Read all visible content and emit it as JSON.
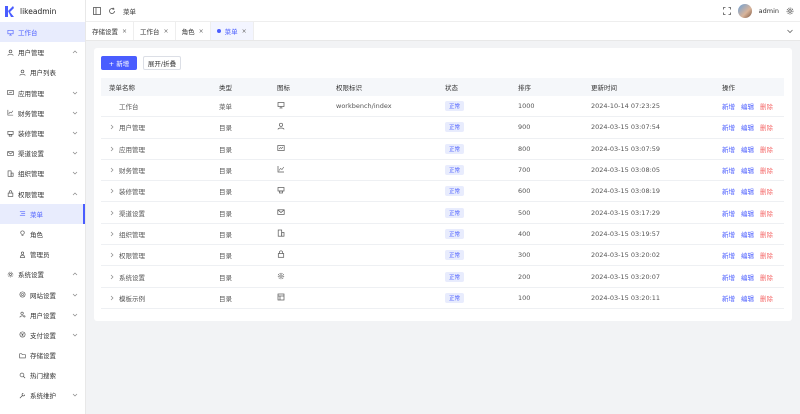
{
  "app": {
    "name": "likeadmin"
  },
  "header": {
    "title": "菜单",
    "admin": "admin"
  },
  "sidebar": {
    "items": [
      {
        "label": "工作台",
        "icon": "monitor-icon",
        "level": 0,
        "active": true,
        "arrow": false
      },
      {
        "label": "用户管理",
        "icon": "user-icon",
        "level": 0,
        "arrow": "up"
      },
      {
        "label": "用户列表",
        "icon": "user-icon",
        "level": 1
      },
      {
        "label": "应用管理",
        "icon": "app-icon",
        "level": 0,
        "arrow": "down"
      },
      {
        "label": "财务管理",
        "icon": "finance-icon",
        "level": 0,
        "arrow": "down"
      },
      {
        "label": "装修管理",
        "icon": "decor-icon",
        "level": 0,
        "arrow": "down"
      },
      {
        "label": "渠道设置",
        "icon": "mail-icon",
        "level": 0,
        "arrow": "down"
      },
      {
        "label": "组织管理",
        "icon": "building-icon",
        "level": 0,
        "arrow": "down"
      },
      {
        "label": "权限管理",
        "icon": "lock-icon",
        "level": 0,
        "arrow": "up"
      },
      {
        "label": "菜单",
        "icon": "menu-icon",
        "level": 1,
        "active": true
      },
      {
        "label": "角色",
        "icon": "bulb-icon",
        "level": 1
      },
      {
        "label": "管理员",
        "icon": "person-icon",
        "level": 1
      },
      {
        "label": "系统设置",
        "icon": "gear-icon",
        "level": 0,
        "arrow": "up"
      },
      {
        "label": "网站设置",
        "icon": "globe-icon",
        "level": 1,
        "arrow": "down"
      },
      {
        "label": "用户设置",
        "icon": "user-gear-icon",
        "level": 1,
        "arrow": "down"
      },
      {
        "label": "支付设置",
        "icon": "pay-icon",
        "level": 1,
        "arrow": "down"
      },
      {
        "label": "存储设置",
        "icon": "folder-icon",
        "level": 1
      },
      {
        "label": "热门搜索",
        "icon": "search-icon",
        "level": 1
      },
      {
        "label": "系统维护",
        "icon": "tools-icon",
        "level": 1,
        "arrow": "down"
      }
    ]
  },
  "tabs": [
    {
      "label": "存储设置",
      "close": "×",
      "active": false
    },
    {
      "label": "工作台",
      "close": "×",
      "active": false
    },
    {
      "label": "角色",
      "close": "×",
      "active": false
    },
    {
      "label": "菜单",
      "close": "×",
      "active": true
    }
  ],
  "toolbar": {
    "add_label": "+ 新增",
    "toggle_label": "展开/折叠"
  },
  "table": {
    "headers": [
      "菜单名称",
      "类型",
      "图标",
      "权限标识",
      "状态",
      "排序",
      "更新时间",
      "操作"
    ],
    "rows": [
      {
        "name": "工作台",
        "expand": false,
        "type": "菜单",
        "icon": "monitor-icon",
        "perm": "workbench/index",
        "status": "正常",
        "sort": "1000",
        "time": "2024-10-14 07:23:25"
      },
      {
        "name": "用户管理",
        "expand": true,
        "type": "目录",
        "icon": "user-icon",
        "perm": "",
        "status": "正常",
        "sort": "900",
        "time": "2024-03-15 03:07:54"
      },
      {
        "name": "应用管理",
        "expand": true,
        "type": "目录",
        "icon": "app-icon",
        "perm": "",
        "status": "正常",
        "sort": "800",
        "time": "2024-03-15 03:07:59"
      },
      {
        "name": "财务管理",
        "expand": true,
        "type": "目录",
        "icon": "finance-icon",
        "perm": "",
        "status": "正常",
        "sort": "700",
        "time": "2024-03-15 03:08:05"
      },
      {
        "name": "装修管理",
        "expand": true,
        "type": "目录",
        "icon": "decor-icon",
        "perm": "",
        "status": "正常",
        "sort": "600",
        "time": "2024-03-15 03:08:19"
      },
      {
        "name": "渠道设置",
        "expand": true,
        "type": "目录",
        "icon": "mail-icon",
        "perm": "",
        "status": "正常",
        "sort": "500",
        "time": "2024-03-15 03:17:29"
      },
      {
        "name": "组织管理",
        "expand": true,
        "type": "目录",
        "icon": "building-icon",
        "perm": "",
        "status": "正常",
        "sort": "400",
        "time": "2024-03-15 03:19:57"
      },
      {
        "name": "权限管理",
        "expand": true,
        "type": "目录",
        "icon": "lock-icon",
        "perm": "",
        "status": "正常",
        "sort": "300",
        "time": "2024-03-15 03:20:02"
      },
      {
        "name": "系统设置",
        "expand": true,
        "type": "目录",
        "icon": "gear-icon",
        "perm": "",
        "status": "正常",
        "sort": "200",
        "time": "2024-03-15 03:20:07"
      },
      {
        "name": "模板示例",
        "expand": true,
        "type": "目录",
        "icon": "template-icon",
        "perm": "",
        "status": "正常",
        "sort": "100",
        "time": "2024-03-15 03:20:11"
      }
    ],
    "ops": {
      "add": "新增",
      "edit": "编辑",
      "del": "删除"
    }
  },
  "colors": {
    "primary": "#4a5dff",
    "danger": "#f56c6c",
    "active_bg": "#e8ecfd"
  }
}
